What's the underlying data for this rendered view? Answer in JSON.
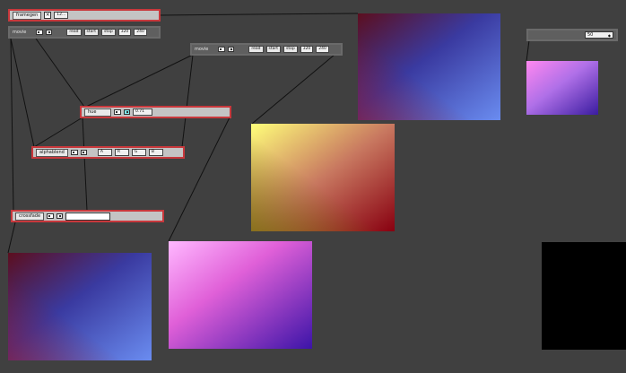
{
  "framegen": {
    "name": "framegen",
    "check": "×",
    "value": "12..."
  },
  "movie1": {
    "name": "movie",
    "read": "read",
    "start": "start",
    "stop": "stop",
    "width": "320",
    "height": "240"
  },
  "movie2": {
    "name": "movie",
    "read": "read",
    "start": "start",
    "stop": "stop",
    "width": "320",
    "height": "240"
  },
  "hue": {
    "name": "hue",
    "value": "0.71"
  },
  "alphablend": {
    "name": "alphablend",
    "a": "A",
    "r": "R",
    "g": "G",
    "b": "B"
  },
  "crossfade": {
    "name": "crossfade"
  },
  "dropdown": {
    "value": "50",
    "arrow": "◆"
  },
  "colors": {
    "wire": "#111111",
    "object_border": "#c8383c",
    "canvas": "#404040"
  }
}
